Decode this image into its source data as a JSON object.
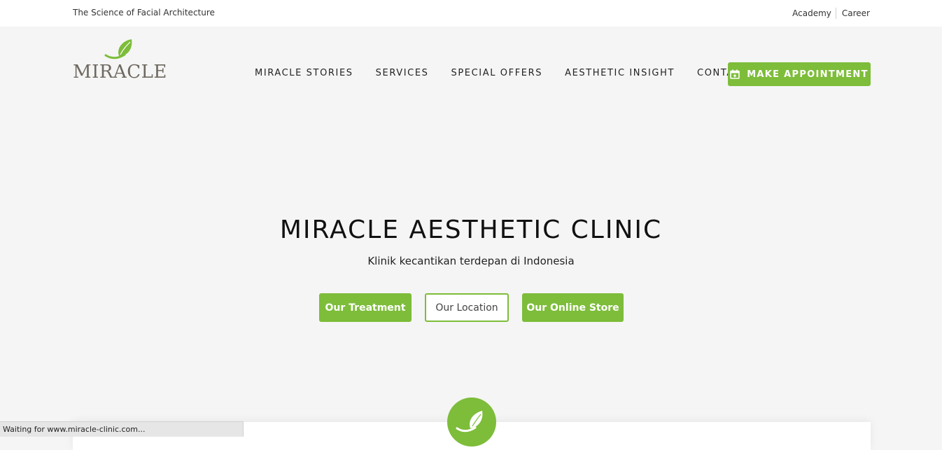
{
  "topbar": {
    "tagline": "The Science of Facial Architecture",
    "links": [
      "Academy",
      "Career"
    ]
  },
  "header": {
    "logo_text": "MIRACLE",
    "nav": [
      "MIRACLE STORIES",
      "SERVICES",
      "SPECIAL OFFERS",
      "AESTHETIC INSIGHT",
      "CONTACT"
    ],
    "appointment_label": "MAKE APPOINTMENT",
    "appointment_icon": "calendar-plus-icon"
  },
  "hero": {
    "title": "MIRACLE AESTHETIC CLINIC",
    "subtitle": "Klinik kecantikan terdepan di Indonesia",
    "buttons": [
      "Our Treatment",
      "Our Location",
      "Our Online Store"
    ]
  },
  "status_bar": {
    "text": "Waiting for www.miracle-clinic.com..."
  },
  "colors": {
    "accent": "#7dbd3a",
    "background": "#f5f5f5",
    "logo_text": "#6e6960"
  }
}
